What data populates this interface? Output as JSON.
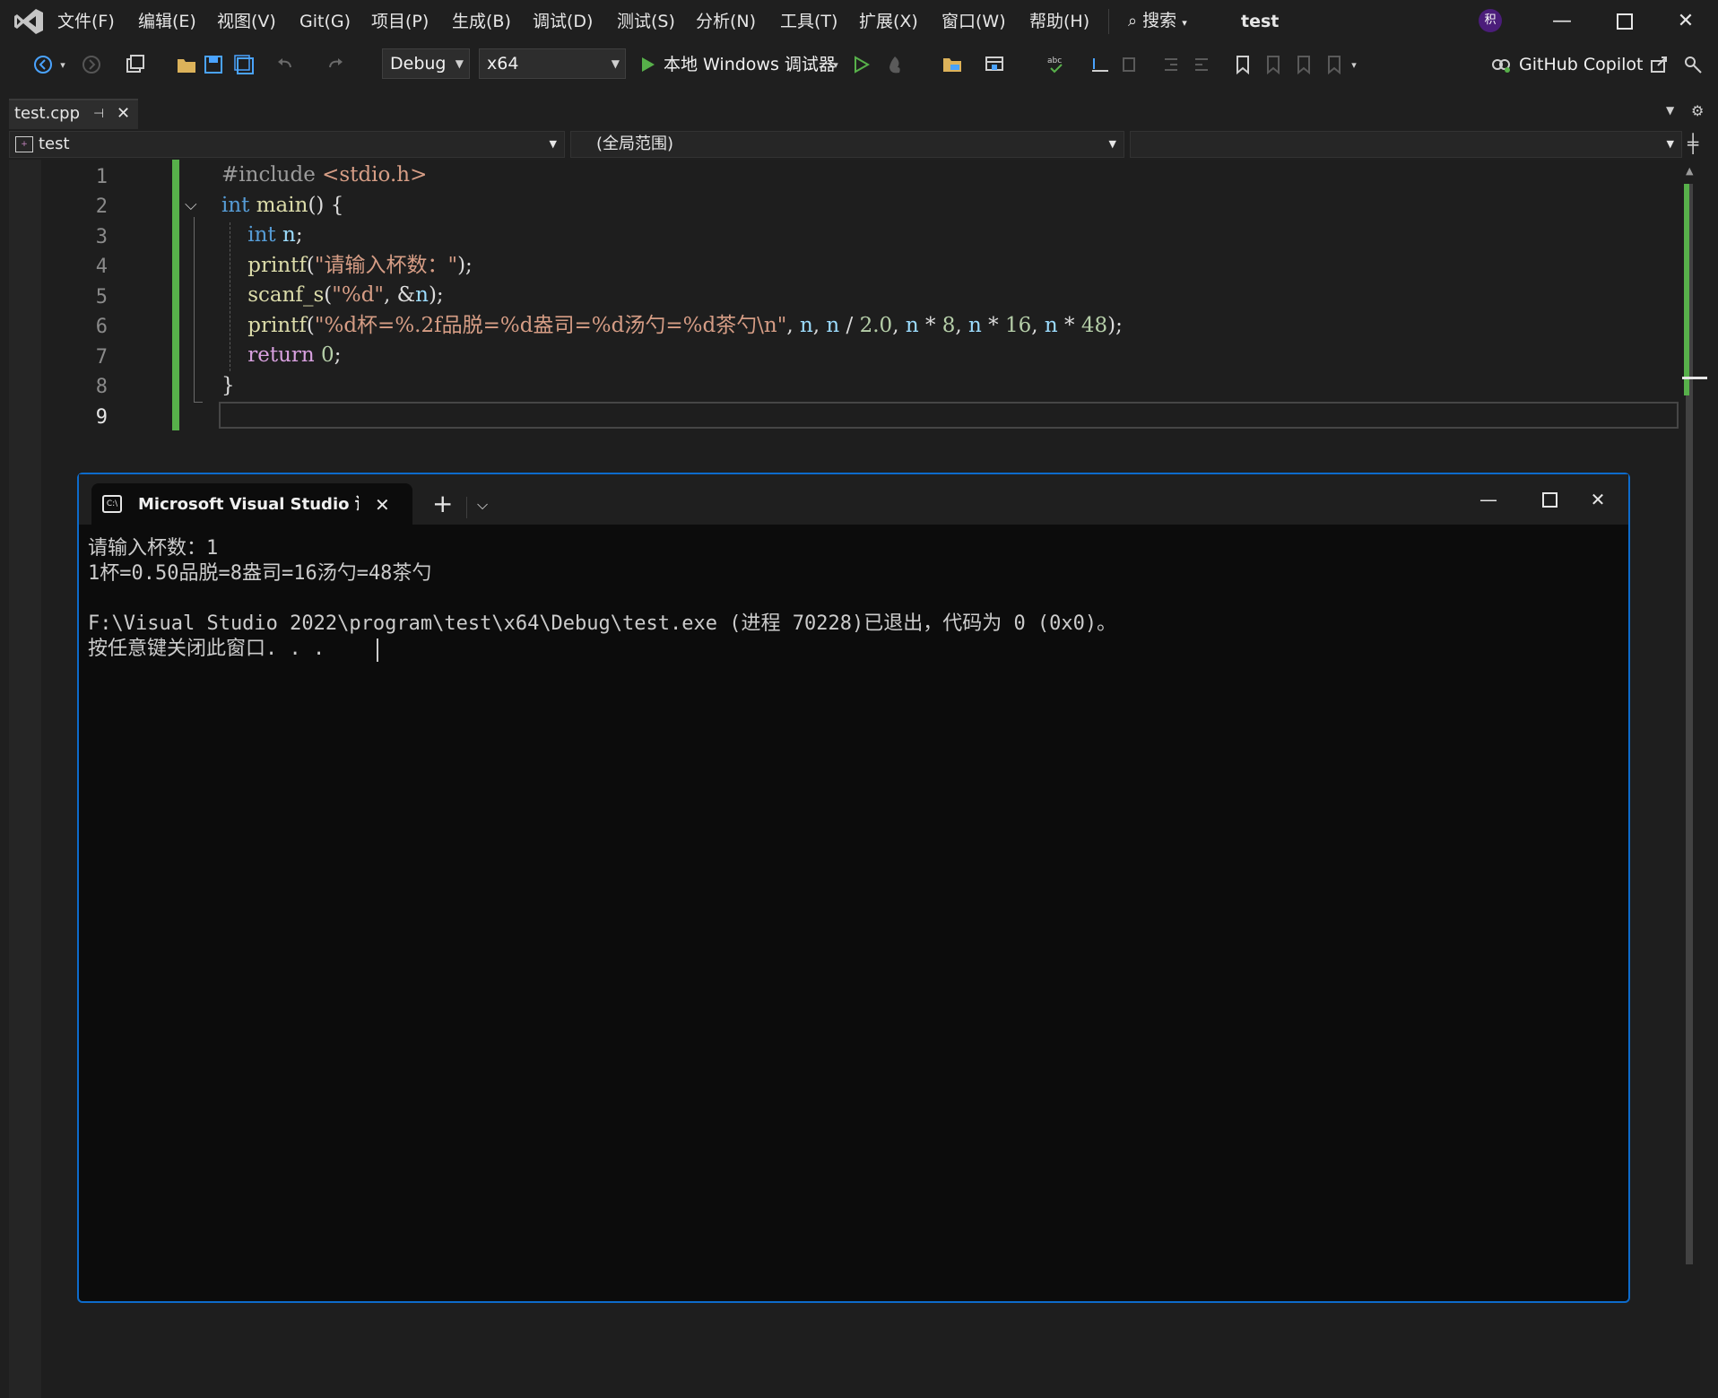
{
  "menu": {
    "items": [
      "文件(F)",
      "编辑(E)",
      "视图(V)",
      "Git(G)",
      "项目(P)",
      "生成(B)",
      "调试(D)",
      "测试(S)",
      "分析(N)",
      "工具(T)",
      "扩展(X)",
      "窗口(W)",
      "帮助(H)"
    ],
    "search_label": "搜索",
    "project_title": "test",
    "avatar_text": "积"
  },
  "toolbar": {
    "config": "Debug",
    "platform": "x64",
    "run_label": "本地 Windows 调试器",
    "copilot_label": "GitHub Copilot"
  },
  "tabs": {
    "active_file": "test.cpp"
  },
  "navbar": {
    "project": "test",
    "scope": "(全局范围)"
  },
  "editor": {
    "line_numbers": [
      "1",
      "2",
      "3",
      "4",
      "5",
      "6",
      "7",
      "8",
      "9"
    ],
    "current_line": "9"
  },
  "terminal": {
    "tab_label": "Microsoft Visual Studio 调试控制台",
    "lines": [
      "请输入杯数：1",
      "1杯=0.50品脱=8盎司=16汤勺=48茶勺",
      "",
      "F:\\Visual Studio 2022\\program\\test\\x64\\Debug\\test.exe (进程 70228)已退出，代码为 0 (0x0)。",
      "按任意键关闭此窗口. . ."
    ]
  },
  "colors": {
    "accent": "#0d6bcb",
    "git_change": "#57b04a",
    "keyword": "#569cd6",
    "string": "#d69d85"
  }
}
